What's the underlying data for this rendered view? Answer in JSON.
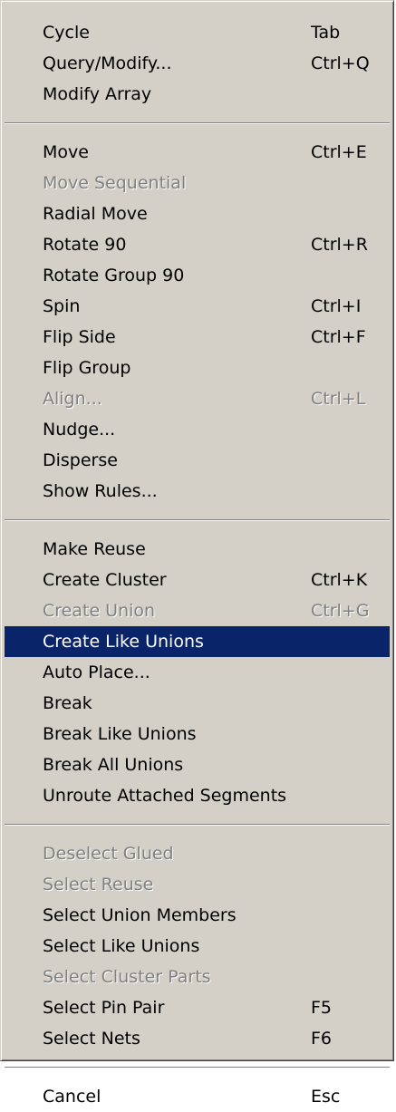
{
  "menu": {
    "groups": [
      [
        {
          "label": "Cycle",
          "shortcut": "Tab",
          "enabled": true
        },
        {
          "label": "Query/Modify...",
          "shortcut": "Ctrl+Q",
          "enabled": true
        },
        {
          "label": "Modify Array",
          "shortcut": "",
          "enabled": true
        }
      ],
      [
        {
          "label": "Move",
          "shortcut": "Ctrl+E",
          "enabled": true
        },
        {
          "label": "Move Sequential",
          "shortcut": "",
          "enabled": false
        },
        {
          "label": "Radial Move",
          "shortcut": "",
          "enabled": true
        },
        {
          "label": "Rotate 90",
          "shortcut": "Ctrl+R",
          "enabled": true
        },
        {
          "label": "Rotate Group 90",
          "shortcut": "",
          "enabled": true
        },
        {
          "label": "Spin",
          "shortcut": "Ctrl+I",
          "enabled": true
        },
        {
          "label": "Flip Side",
          "shortcut": "Ctrl+F",
          "enabled": true
        },
        {
          "label": "Flip Group",
          "shortcut": "",
          "enabled": true
        },
        {
          "label": "Align...",
          "shortcut": "Ctrl+L",
          "enabled": false
        },
        {
          "label": "Nudge...",
          "shortcut": "",
          "enabled": true
        },
        {
          "label": "Disperse",
          "shortcut": "",
          "enabled": true
        },
        {
          "label": "Show Rules...",
          "shortcut": "",
          "enabled": true
        }
      ],
      [
        {
          "label": "Make Reuse",
          "shortcut": "",
          "enabled": true
        },
        {
          "label": "Create Cluster",
          "shortcut": "Ctrl+K",
          "enabled": true
        },
        {
          "label": "Create Union",
          "shortcut": "Ctrl+G",
          "enabled": false
        },
        {
          "label": "Create Like Unions",
          "shortcut": "",
          "enabled": true,
          "highlighted": true
        },
        {
          "label": "Auto Place...",
          "shortcut": "",
          "enabled": true
        },
        {
          "label": "Break",
          "shortcut": "",
          "enabled": true
        },
        {
          "label": "Break Like Unions",
          "shortcut": "",
          "enabled": true
        },
        {
          "label": "Break All Unions",
          "shortcut": "",
          "enabled": true
        },
        {
          "label": "Unroute Attached Segments",
          "shortcut": "",
          "enabled": true
        }
      ],
      [
        {
          "label": "Deselect Glued",
          "shortcut": "",
          "enabled": false
        },
        {
          "label": "Select Reuse",
          "shortcut": "",
          "enabled": false
        },
        {
          "label": "Select Union Members",
          "shortcut": "",
          "enabled": true
        },
        {
          "label": "Select Like Unions",
          "shortcut": "",
          "enabled": true
        },
        {
          "label": "Select Cluster Parts",
          "shortcut": "",
          "enabled": false
        },
        {
          "label": "Select Pin Pair",
          "shortcut": "F5",
          "enabled": true
        },
        {
          "label": "Select Nets",
          "shortcut": "F6",
          "enabled": true
        }
      ],
      [
        {
          "label": "Cancel",
          "shortcut": "Esc",
          "enabled": true
        }
      ]
    ],
    "colors": {
      "background": "#d4d0c8",
      "highlight": "#0a246a",
      "disabled_text": "#808080"
    }
  }
}
